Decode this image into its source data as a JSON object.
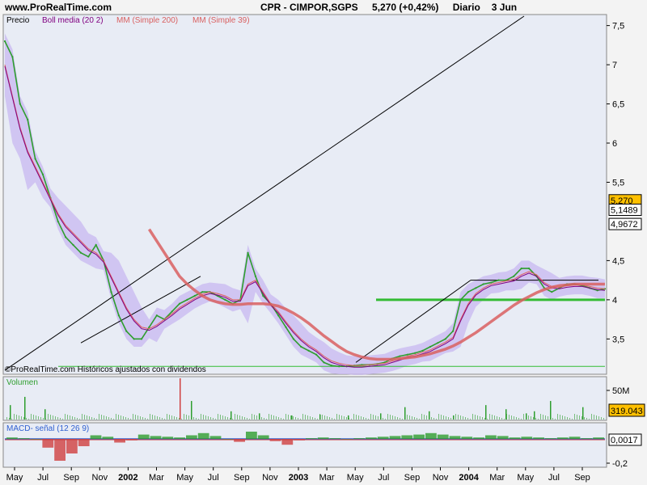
{
  "header": {
    "site": "www.ProRealTime.com",
    "symbol": "CPR - CIMPOR,SGPS",
    "quote": "5,270 (+0,42%)",
    "period": "Diario",
    "date": "3 Jun"
  },
  "colors": {
    "price": "#2e9e2e",
    "ma200": "#d96060",
    "ma39": "#e06060",
    "boll": "#c8b8f0",
    "boll_mid": "#800080",
    "green_line": "#33bb33",
    "macd": "#3060d0",
    "signal": "#d04040"
  },
  "chart_data": [
    {
      "type": "line",
      "panel": "price",
      "legend": [
        "Precio",
        "Boll media (20 2)",
        "MM (Simple 200)",
        "MM (Simple 39)"
      ],
      "footer": "©ProRealTime.com Históricos ajustados con dividendos",
      "y_ticks": [
        "7,5",
        "7",
        "6,5",
        "6",
        "5,5",
        "4,5",
        "4",
        "3,5"
      ],
      "y_tick_values": [
        7.5,
        7,
        6.5,
        6,
        5.5,
        4.5,
        4,
        3.5
      ],
      "ylim": [
        3.07,
        7.62
      ],
      "x_labels": [
        "May",
        "Jul",
        "Sep",
        "Nov",
        "2002",
        "Mar",
        "May",
        "Jul",
        "Sep",
        "Nov",
        "2003",
        "Mar",
        "May",
        "Jul",
        "Sep",
        "Nov",
        "2004",
        "Mar",
        "May",
        "Jul",
        "Sep"
      ],
      "x_bold": [
        false,
        false,
        false,
        false,
        true,
        false,
        false,
        false,
        false,
        false,
        true,
        false,
        false,
        false,
        false,
        false,
        true,
        false,
        false,
        false,
        false
      ],
      "value_badges": [
        {
          "text": "5,270",
          "value": 5.27,
          "style": "price"
        },
        {
          "text": "5,1489",
          "value": 5.149,
          "style": "boll"
        },
        {
          "text": "4,9672",
          "value": 4.967,
          "style": "ma"
        }
      ],
      "price": [
        7.3,
        7.1,
        6.5,
        6.3,
        5.8,
        5.6,
        5.3,
        5.0,
        4.8,
        4.7,
        4.6,
        4.55,
        4.7,
        4.5,
        4.1,
        3.8,
        3.6,
        3.5,
        3.5,
        3.65,
        3.8,
        3.75,
        3.85,
        3.95,
        4.0,
        4.05,
        4.1,
        4.1,
        4.05,
        4.0,
        3.95,
        4.0,
        4.6,
        4.3,
        4.05,
        3.95,
        3.8,
        3.65,
        3.5,
        3.4,
        3.35,
        3.3,
        3.2,
        3.16,
        3.15,
        3.15,
        3.16,
        3.17,
        3.17,
        3.18,
        3.2,
        3.25,
        3.28,
        3.3,
        3.32,
        3.35,
        3.4,
        3.45,
        3.5,
        3.6,
        4.0,
        4.1,
        4.15,
        4.2,
        4.22,
        4.25,
        4.25,
        4.3,
        4.4,
        4.4,
        4.3,
        4.15,
        4.1,
        4.15,
        4.2,
        4.2,
        4.18,
        4.15,
        4.12,
        4.14
      ],
      "ma39": [
        7.0,
        6.6,
        6.2,
        5.9,
        5.7,
        5.5,
        5.3,
        5.1,
        4.95,
        4.85,
        4.75,
        4.65,
        4.6,
        4.5,
        4.3,
        4.1,
        3.9,
        3.75,
        3.65,
        3.63,
        3.68,
        3.75,
        3.82,
        3.9,
        3.96,
        4.02,
        4.07,
        4.1,
        4.08,
        4.05,
        4.0,
        4.0,
        4.2,
        4.25,
        4.1,
        3.95,
        3.85,
        3.72,
        3.6,
        3.5,
        3.42,
        3.36,
        3.28,
        3.22,
        3.19,
        3.17,
        3.16,
        3.16,
        3.17,
        3.18,
        3.19,
        3.22,
        3.25,
        3.28,
        3.3,
        3.33,
        3.36,
        3.41,
        3.46,
        3.52,
        3.75,
        3.95,
        4.08,
        4.15,
        4.2,
        4.22,
        4.24,
        4.26,
        4.32,
        4.36,
        4.32,
        4.22,
        4.17,
        4.16,
        4.18,
        4.19,
        4.19,
        4.17,
        4.15,
        4.14
      ],
      "ma200": [
        null,
        null,
        null,
        null,
        null,
        null,
        null,
        null,
        null,
        null,
        null,
        null,
        null,
        null,
        null,
        null,
        null,
        null,
        null,
        4.9,
        4.75,
        4.6,
        4.45,
        4.3,
        4.2,
        4.12,
        4.05,
        4.0,
        3.97,
        3.95,
        3.94,
        3.94,
        3.95,
        3.95,
        3.95,
        3.94,
        3.92,
        3.88,
        3.83,
        3.77,
        3.7,
        3.62,
        3.54,
        3.47,
        3.4,
        3.34,
        3.3,
        3.27,
        3.25,
        3.24,
        3.24,
        3.24,
        3.25,
        3.26,
        3.27,
        3.29,
        3.31,
        3.34,
        3.37,
        3.41,
        3.46,
        3.52,
        3.58,
        3.65,
        3.72,
        3.79,
        3.86,
        3.93,
        3.99,
        4.04,
        4.09,
        4.13,
        4.16,
        4.18,
        4.19,
        4.2,
        4.2,
        4.2,
        4.2,
        4.2
      ],
      "green_support": 4.0,
      "baseline": 3.15
    },
    {
      "type": "bar",
      "panel": "volume",
      "legend": "Volumen",
      "y_ticks": [
        "50M"
      ],
      "badge": "319.043",
      "volume_spikes": [
        0.35,
        0.55,
        0.25,
        1.0,
        0.45,
        0.2,
        0.15,
        0.1,
        0.12,
        0.1,
        0.15,
        0.3,
        0.2,
        0.1,
        0.35,
        0.25,
        0.15,
        0.2,
        0.45,
        0.3
      ]
    },
    {
      "type": "bar",
      "panel": "macd",
      "legend": "MACD- señal (12 26 9)",
      "y_ticks": [
        "-0,2"
      ],
      "badge": "0,0017",
      "macd_hist": [
        0.02,
        0.01,
        0.0,
        -0.12,
        -0.3,
        -0.2,
        -0.1,
        0.05,
        0.03,
        -0.05,
        -0.02,
        0.06,
        0.04,
        0.03,
        0.02,
        0.05,
        0.08,
        0.04,
        0.0,
        -0.04,
        0.1,
        0.05,
        -0.03,
        -0.08,
        -0.02,
        0.01,
        0.02,
        0.01,
        0.0,
        0.01,
        0.02,
        0.03,
        0.04,
        0.05,
        0.06,
        0.08,
        0.06,
        0.04,
        0.03,
        0.02,
        0.05,
        0.04,
        0.02,
        0.03,
        0.02,
        0.01,
        0.02,
        0.03,
        0.01,
        0.02
      ]
    }
  ]
}
